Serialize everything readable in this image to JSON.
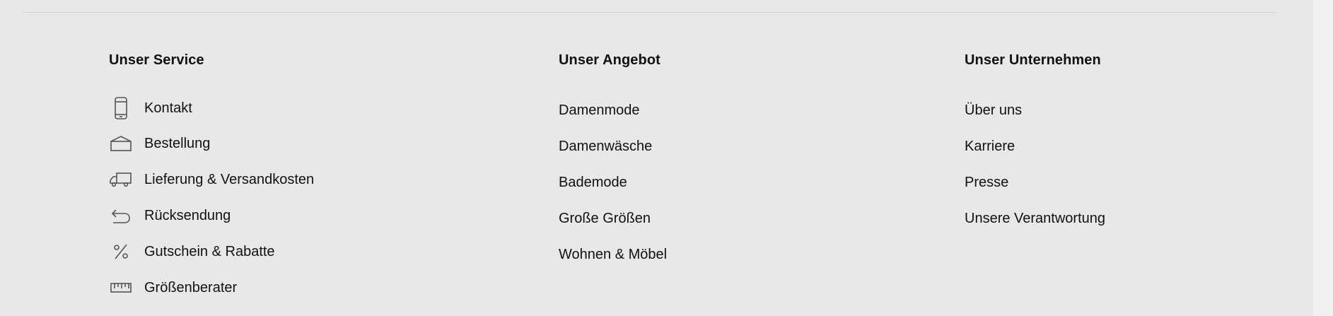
{
  "footer": {
    "service": {
      "title": "Unser Service",
      "items": [
        {
          "label": "Kontakt",
          "icon": "phone-icon"
        },
        {
          "label": "Bestellung",
          "icon": "box-icon"
        },
        {
          "label": "Lieferung & Versandkosten",
          "icon": "truck-icon"
        },
        {
          "label": "Rücksendung",
          "icon": "return-arrow-icon"
        },
        {
          "label": "Gutschein & Rabatte",
          "icon": "percent-icon"
        },
        {
          "label": "Größenberater",
          "icon": "ruler-icon"
        }
      ]
    },
    "offer": {
      "title": "Unser Angebot",
      "items": [
        {
          "label": "Damenmode"
        },
        {
          "label": "Damenwäsche"
        },
        {
          "label": "Bademode"
        },
        {
          "label": "Große Größen"
        },
        {
          "label": "Wohnen & Möbel"
        }
      ]
    },
    "company": {
      "title": "Unser Unternehmen",
      "items": [
        {
          "label": "Über uns"
        },
        {
          "label": "Karriere"
        },
        {
          "label": "Presse"
        },
        {
          "label": "Unsere Verantwortung"
        }
      ]
    }
  },
  "colors": {
    "background": "#e8e8e8",
    "text": "#111111",
    "divider": "#cfcfcf",
    "icon_stroke": "#555555"
  }
}
